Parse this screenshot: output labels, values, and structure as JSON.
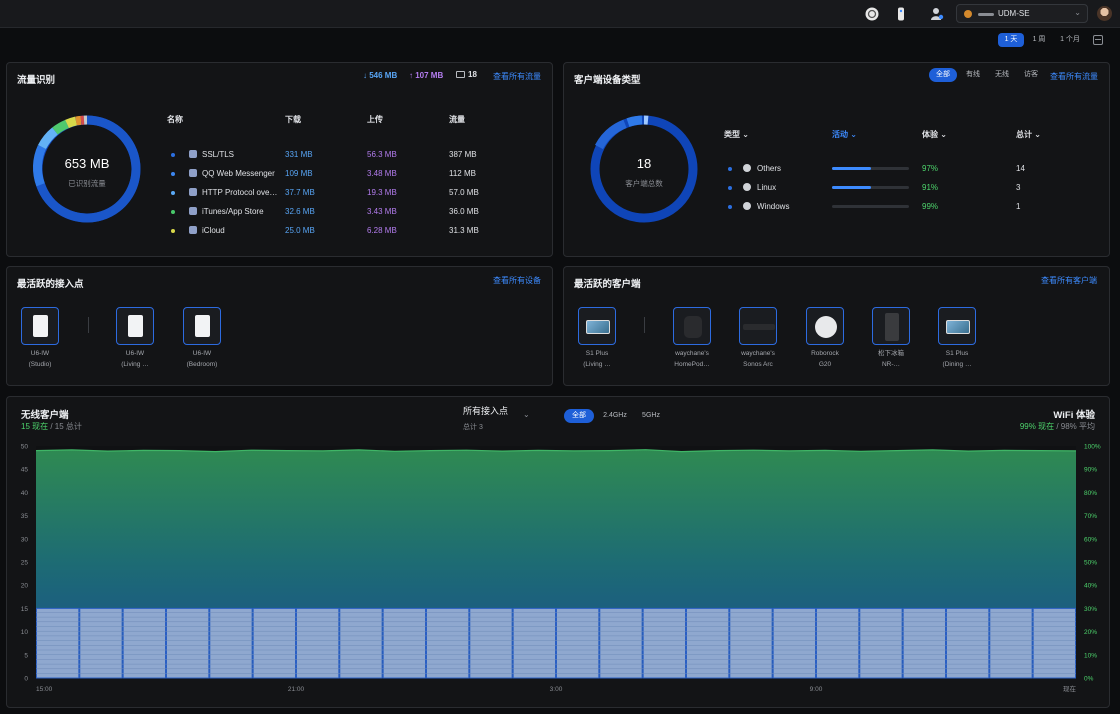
{
  "header": {
    "site_name": "UDM-SE",
    "time_ranges": [
      "1 天",
      "1 周",
      "1 个月"
    ]
  },
  "traffic": {
    "title": "流量识别",
    "download_total": "546 MB",
    "upload_total": "107 MB",
    "device_count": "18",
    "view_all": "查看所有流量",
    "total": "653 MB",
    "total_label": "已识别流量",
    "columns": [
      "名称",
      "下载",
      "上传",
      "流量"
    ],
    "rows": [
      {
        "name": "SSL/TLS",
        "down": "331 MB",
        "up": "56.3 MB",
        "total": "387 MB",
        "dot": "#2b6fe0"
      },
      {
        "name": "QQ Web Messenger",
        "down": "109 MB",
        "up": "3.48 MB",
        "total": "112 MB",
        "dot": "#3c86f0"
      },
      {
        "name": "HTTP Protocol ove…",
        "down": "37.7 MB",
        "up": "19.3 MB",
        "total": "57.0 MB",
        "dot": "#5aa9f5"
      },
      {
        "name": "iTunes/App Store",
        "down": "32.6 MB",
        "up": "3.43 MB",
        "total": "36.0 MB",
        "dot": "#48c96a"
      },
      {
        "name": "iCloud",
        "down": "25.0 MB",
        "up": "6.28 MB",
        "total": "31.3 MB",
        "dot": "#d8d84a"
      }
    ]
  },
  "clients": {
    "title": "客户端设备类型",
    "filters": [
      "全部",
      "有线",
      "无线",
      "访客"
    ],
    "view_all": "查看所有流量",
    "count": "18",
    "count_label": "客户端总数",
    "columns": [
      "类型",
      "活动",
      "体验",
      "总计"
    ],
    "rows": [
      {
        "type": "Others",
        "activity": 0.5,
        "experience": "97%",
        "total": "14"
      },
      {
        "type": "Linux",
        "activity": 0.5,
        "experience": "91%",
        "total": "3"
      },
      {
        "type": "Windows",
        "activity": 0.0,
        "experience": "99%",
        "total": "1"
      }
    ]
  },
  "ap": {
    "title": "最活跃的接入点",
    "view_all": "查看所有设备",
    "items": [
      {
        "l1": "U6-IW",
        "l2": "(Studio)"
      },
      {
        "l1": "U6-IW",
        "l2": "(Living …"
      },
      {
        "l1": "U6-IW",
        "l2": "(Bedroom)"
      }
    ]
  },
  "top_clients": {
    "title": "最活跃的客户端",
    "view_all": "查看所有客户端",
    "items": [
      {
        "l1": "S1 Plus",
        "l2": "(Living …",
        "icon": "tablet-icon"
      },
      {
        "l1": "waychane's",
        "l2": "HomePod…",
        "icon": "homepod-icon"
      },
      {
        "l1": "waychane's",
        "l2": "Sonos Arc",
        "icon": "soundbar-icon"
      },
      {
        "l1": "Roborock",
        "l2": "G20",
        "icon": "robot-vacuum-icon"
      },
      {
        "l1": "松下冰箱",
        "l2": "NR-…",
        "icon": "fridge-icon"
      },
      {
        "l1": "S1 Plus",
        "l2": "(Dining …",
        "icon": "tablet-icon"
      }
    ]
  },
  "wireless": {
    "title": "无线客户端",
    "current": "15 现在",
    "total": "/ 15 总计",
    "ap_select": "所有接入点",
    "ap_sub": "总计 3",
    "bands": [
      "全部",
      "2.4GHz",
      "5GHz"
    ],
    "wifi_title": "WiFi 体验",
    "wifi_current": "99% 现在",
    "wifi_avg": "/ 98% 平均"
  },
  "chart_data": {
    "type": "area",
    "x_ticks": [
      "15:00",
      "21:00",
      "3:00",
      "9:00",
      "现在"
    ],
    "y_left_ticks": [
      "50",
      "45",
      "40",
      "35",
      "30",
      "25",
      "20",
      "15",
      "10",
      "5",
      "0"
    ],
    "y_right_ticks": [
      "100%",
      "90%",
      "80%",
      "70%",
      "60%",
      "50%",
      "40%",
      "30%",
      "20%",
      "10%",
      "0%"
    ],
    "y_left_range": [
      0,
      50
    ],
    "y_right_range": [
      0,
      100
    ],
    "series": [
      {
        "values": [
          98,
          98.3,
          97.8,
          98.1,
          98,
          97.6,
          98.2,
          98,
          97.9,
          98.3,
          97.7,
          98,
          98.2,
          97.8,
          98.1,
          97.9,
          98,
          98.4,
          97.6,
          98,
          98.2,
          97.9,
          98.1,
          97.7,
          98,
          98.3,
          97.8,
          98.1,
          98,
          97.9
        ]
      },
      {
        "values": [
          15,
          15,
          15,
          15,
          15,
          15,
          15,
          15,
          15,
          15,
          15,
          15,
          15,
          15,
          15,
          15,
          15,
          15,
          15,
          15,
          15,
          15,
          15,
          15
        ]
      }
    ]
  }
}
